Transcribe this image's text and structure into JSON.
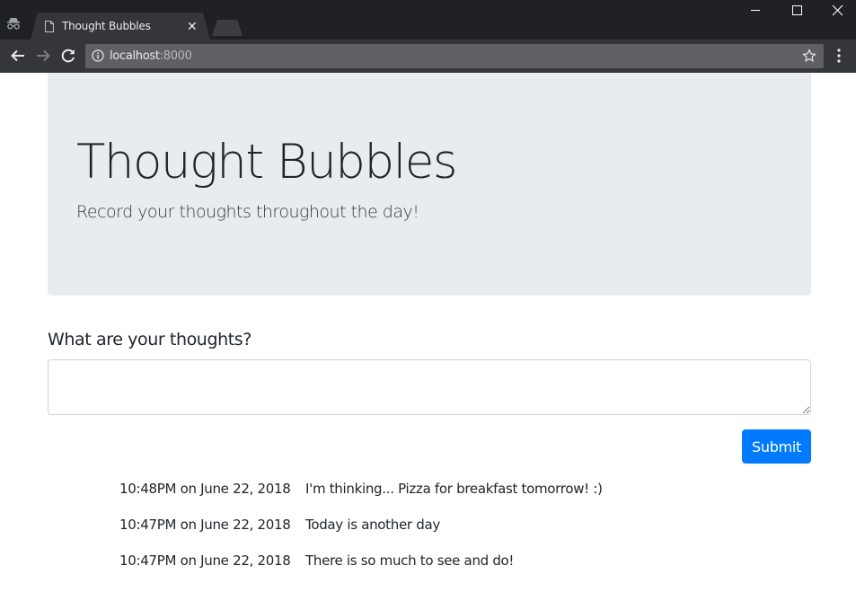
{
  "browser": {
    "tab_title": "Thought Bubbles",
    "url_host": "localhost",
    "url_port": ":8000",
    "icons": {
      "incognito": "incognito-icon",
      "file": "file-icon",
      "back": "back-arrow-icon",
      "forward": "forward-arrow-icon",
      "reload": "reload-icon",
      "info": "info-icon",
      "star": "star-icon",
      "menu": "kebab-menu-icon"
    }
  },
  "header": {
    "title": "Thought Bubbles",
    "lead": "Record your thoughts throughout the day!"
  },
  "form": {
    "label": "What are your thoughts?",
    "input_value": "",
    "submit_label": "Submit"
  },
  "thoughts": [
    {
      "time": "10:48PM on June 22, 2018",
      "text": "I'm thinking... Pizza for breakfast tomorrow! :)"
    },
    {
      "time": "10:47PM on June 22, 2018",
      "text": "Today is another day"
    },
    {
      "time": "10:47PM on June 22, 2018",
      "text": "There is so much to see and do!"
    }
  ],
  "colors": {
    "primary": "#007bff",
    "jumbotron_bg": "#e9ecef",
    "chrome_dark": "#202124",
    "chrome_toolbar": "#35363a"
  }
}
